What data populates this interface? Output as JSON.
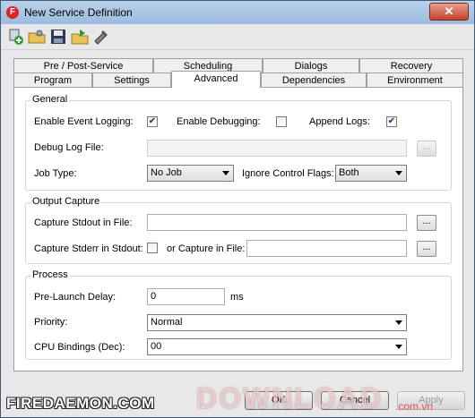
{
  "window": {
    "title": "New Service Definition"
  },
  "titlebar": {
    "app_icon_glyph": "F",
    "close_glyph": "✕"
  },
  "toolbar": {
    "icons": [
      "add-service-icon",
      "open-folder-icon",
      "save-icon",
      "export-icon",
      "tools-icon"
    ]
  },
  "tabs": {
    "row1": [
      "Pre / Post-Service",
      "Scheduling",
      "Dialogs",
      "Recovery"
    ],
    "row2": [
      "Program",
      "Settings",
      "Advanced",
      "Dependencies",
      "Environment"
    ],
    "active": "Advanced"
  },
  "general": {
    "title": "General",
    "enable_event_logging": {
      "label": "Enable Event Logging:",
      "checked": true
    },
    "enable_debugging": {
      "label": "Enable Debugging:",
      "checked": false
    },
    "append_logs": {
      "label": "Append Logs:",
      "checked": true
    },
    "debug_log_file": {
      "label": "Debug Log File:",
      "value": "",
      "browse": "..."
    },
    "job_type": {
      "label": "Job Type:",
      "value": "No Job"
    },
    "ignore_control_flags": {
      "label": "Ignore Control Flags:",
      "value": "Both"
    }
  },
  "output_capture": {
    "title": "Output Capture",
    "stdout": {
      "label": "Capture Stdout in File:",
      "value": "",
      "browse": "..."
    },
    "stderr": {
      "label": "Capture Stderr in Stdout:",
      "checked": false
    },
    "or_capture": {
      "label": "or Capture in File:",
      "value": "",
      "browse": "..."
    }
  },
  "process": {
    "title": "Process",
    "pre_launch_delay": {
      "label": "Pre-Launch Delay:",
      "value": "0",
      "unit": "ms"
    },
    "priority": {
      "label": "Priority:",
      "value": "Normal"
    },
    "cpu_bindings": {
      "label": "CPU Bindings (Dec):",
      "value": "00"
    }
  },
  "buttons": {
    "ok": "OK",
    "cancel": "Cancel",
    "apply": "Apply"
  },
  "watermarks": {
    "left": "FIREDAEMON.COM",
    "right": "DOWNLOAD",
    "right_sub": ".com.vn"
  },
  "colors": {
    "titlebar": "#9cbbe0",
    "close": "#c6402b",
    "check": "#2a2a7a"
  }
}
